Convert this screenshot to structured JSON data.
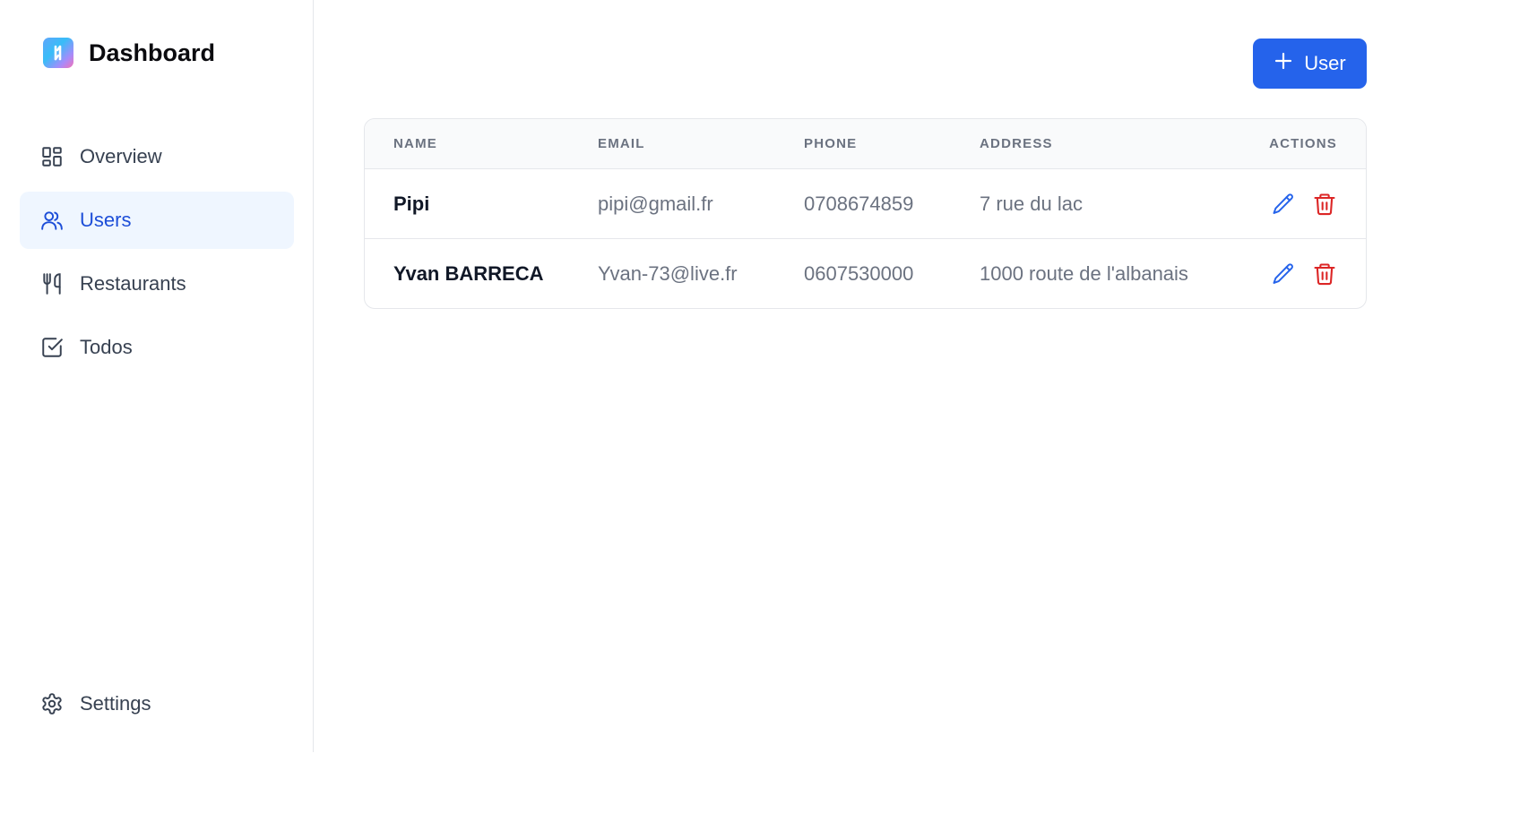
{
  "brand": {
    "title": "Dashboard",
    "icon": "logo-icon"
  },
  "nav": {
    "items": [
      {
        "label": "Overview",
        "icon": "grid-icon",
        "active": false
      },
      {
        "label": "Users",
        "icon": "users-icon",
        "active": true
      },
      {
        "label": "Restaurants",
        "icon": "utensils-icon",
        "active": false
      },
      {
        "label": "Todos",
        "icon": "checkbox-icon",
        "active": false
      }
    ],
    "settings": {
      "label": "Settings",
      "icon": "gear-icon"
    }
  },
  "toolbar": {
    "add_user_label": "User",
    "accent": "#2563eb"
  },
  "table": {
    "headers": {
      "name": "Name",
      "email": "Email",
      "phone": "Phone",
      "address": "Address",
      "actions": "Actions"
    },
    "rows": [
      {
        "name": "Pipi",
        "email": "pipi@gmail.fr",
        "phone": "0708674859",
        "address": "7 rue du lac"
      },
      {
        "name": "Yvan BARRECA",
        "email": "Yvan-73@live.fr",
        "phone": "0607530000",
        "address": "1000 route de l'albanais"
      }
    ]
  },
  "colors": {
    "edit": "#2563eb",
    "delete": "#dc2626",
    "active_bg": "#eff6ff"
  }
}
